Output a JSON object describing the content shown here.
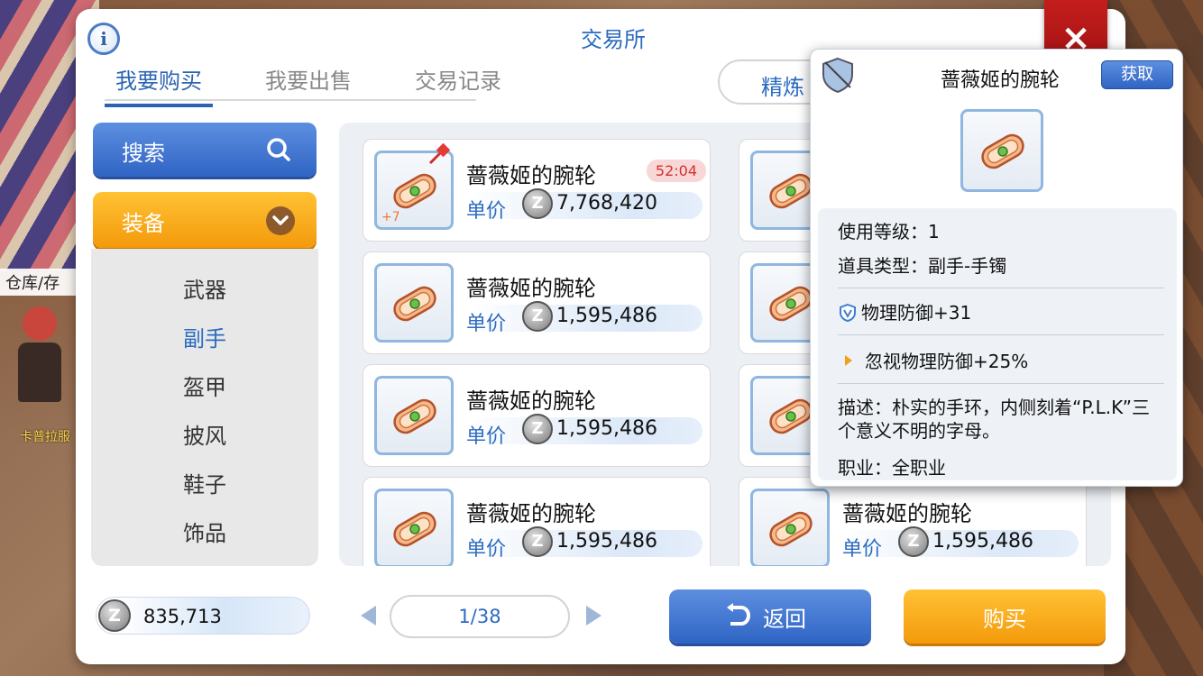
{
  "background": {
    "npc_sign": "仓库/存",
    "npc_name": "卡普拉服"
  },
  "window": {
    "title": "交易所",
    "close_label": "×",
    "info_label": "i"
  },
  "tabs": [
    {
      "label": "我要购买",
      "active": true
    },
    {
      "label": "我要出售",
      "active": false
    },
    {
      "label": "交易记录",
      "active": false
    }
  ],
  "refine_label": "精炼",
  "sidebar": {
    "search_label": "搜索",
    "category_label": "装备",
    "subcategories": [
      {
        "label": "武器",
        "active": false
      },
      {
        "label": "副手",
        "active": true
      },
      {
        "label": "盔甲",
        "active": false
      },
      {
        "label": "披风",
        "active": false
      },
      {
        "label": "鞋子",
        "active": false
      },
      {
        "label": "饰品",
        "active": false
      }
    ]
  },
  "listings": [
    {
      "name": "蔷薇姬的腕轮",
      "price_label": "单价",
      "price": "7,768,420",
      "timer": "52:04",
      "refine": "+7"
    },
    {
      "name": "蔷薇姬的腕轮",
      "price_label": "单价",
      "price": "1,595,486"
    },
    {
      "name": "蔷薇姬的腕轮",
      "price_label": "单价",
      "price": "1,595,486"
    },
    {
      "name": "蔷薇姬的腕轮",
      "price_label": "单价",
      "price": "1,595,486"
    },
    {
      "name": "蔷薇姬的腕轮",
      "price_label": "单价",
      "price": "1,595,486"
    }
  ],
  "footer": {
    "zeny_symbol": "Z",
    "zeny_balance": "835,713",
    "page": "1/38",
    "back_label": "返回",
    "buy_label": "购买"
  },
  "tooltip": {
    "item_name": "蔷薇姬的腕轮",
    "get_label": "获取",
    "level": "使用等级：1",
    "type": "道具类型：副手-手镯",
    "stat1": "物理防御+31",
    "stat2": "忽视物理防御+25%",
    "description": "描述：朴实的手环，内侧刻着“P.L.K”三个意义不明的字母。",
    "job": "职业：全职业"
  },
  "colors": {
    "accent_blue": "#2c6bc0",
    "button_orange": "#f39a0c",
    "close_red": "#c41d1d",
    "timer_red": "#d0312d"
  }
}
